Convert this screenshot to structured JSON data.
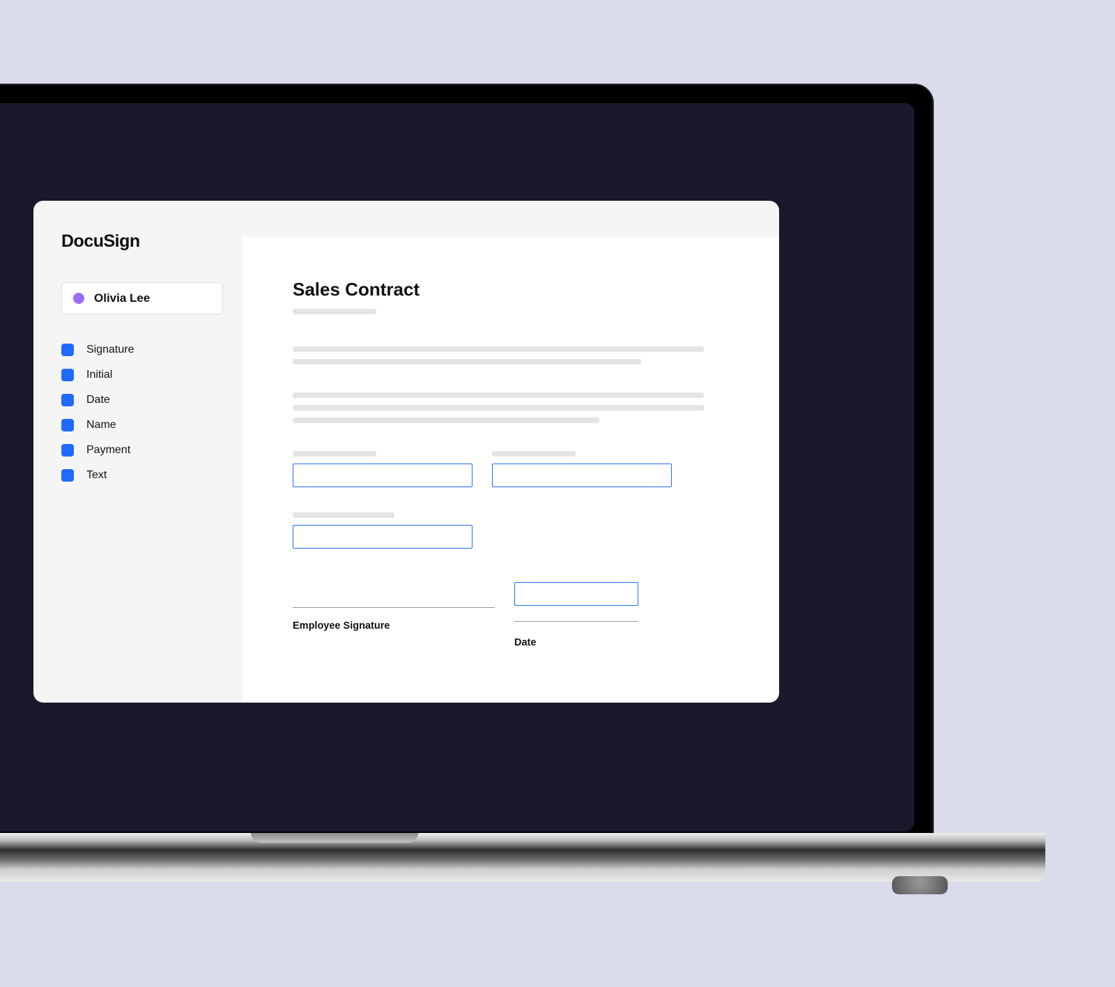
{
  "brand": "DocuSign",
  "recipient": {
    "name": "Olivia Lee",
    "color": "#9b6cff"
  },
  "fields": [
    {
      "label": "Signature"
    },
    {
      "label": "Initial"
    },
    {
      "label": "Date"
    },
    {
      "label": "Name"
    },
    {
      "label": "Payment"
    },
    {
      "label": "Text"
    }
  ],
  "document": {
    "title": "Sales Contract",
    "signature_label": "Employee Signature",
    "date_label": "Date"
  },
  "accent_color": "#1f6bff"
}
